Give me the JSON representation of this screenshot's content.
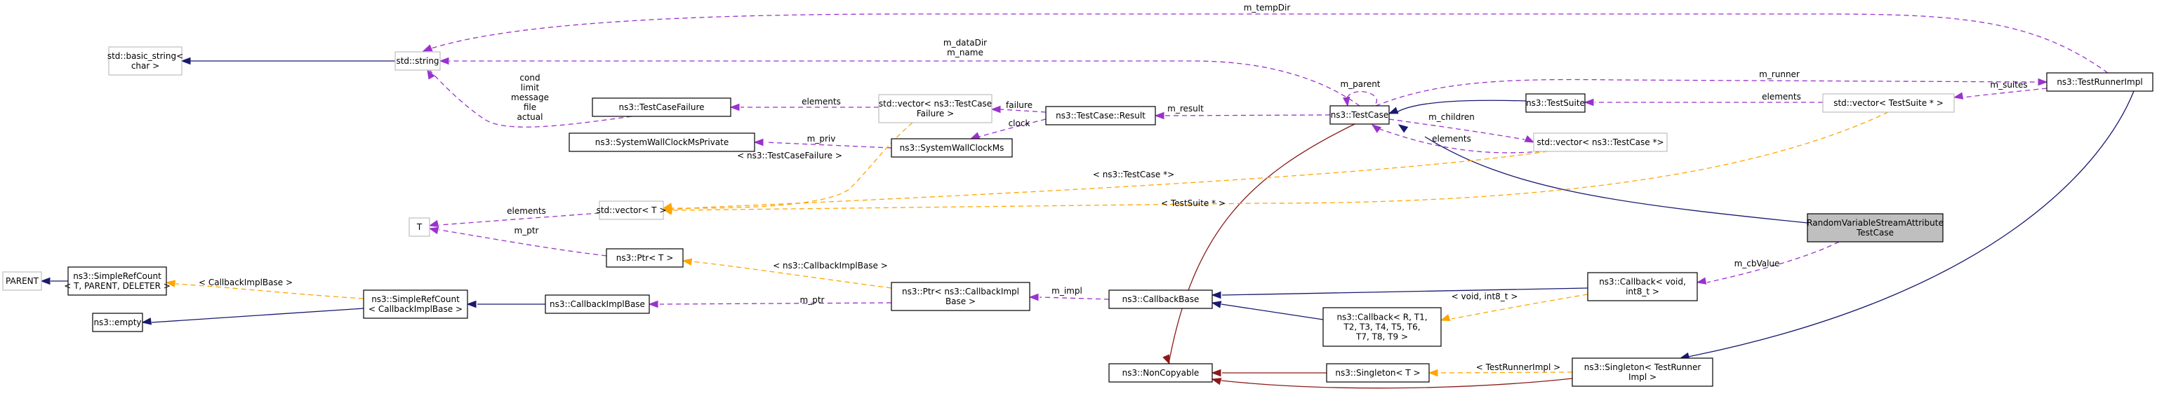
{
  "diagram": {
    "type": "collaboration-graph",
    "focus_node": "RandomVariableStreamAttributeTestCase",
    "colors": {
      "inheritance": "#191970",
      "private_inheritance": "#8b1a1a",
      "usage": "#9a32cd",
      "template_instance": "#ffa500",
      "focus_fill": "#bfbfbf",
      "external_border": "#bfbfbf"
    },
    "nodes": {
      "basic_string": [
        "std::basic_string<",
        "char >"
      ],
      "string": [
        "std::string"
      ],
      "testcasefailure": [
        "ns3::TestCaseFailure"
      ],
      "syswallclockpriv": [
        "ns3::SystemWallClockMsPrivate"
      ],
      "vec_tcf": [
        "std::vector< ns3::TestCase",
        "Failure >"
      ],
      "syswallclock": [
        "ns3::SystemWallClockMs"
      ],
      "result": [
        "ns3::TestCase::Result"
      ],
      "testcase": [
        "ns3::TestCase"
      ],
      "testsuite": [
        "ns3::TestSuite"
      ],
      "vec_ts": [
        "std::vector< TestSuite * >"
      ],
      "testrunnerimpl": [
        "ns3::TestRunnerImpl"
      ],
      "vec_tc": [
        "std::vector< ns3::TestCase *>"
      ],
      "t": [
        "T"
      ],
      "vec_t": [
        "std::vector< T >"
      ],
      "ptr_t": [
        "ns3::Ptr< T >"
      ],
      "parent": [
        "PARENT"
      ],
      "simplerefcount_t": [
        "ns3::SimpleRefCount",
        "< T, PARENT, DELETER >"
      ],
      "empty": [
        "ns3::empty"
      ],
      "simplerefcount_cib": [
        "ns3::SimpleRefCount",
        "< CallbackImplBase >"
      ],
      "callbackimplbase": [
        "ns3::CallbackImplBase"
      ],
      "ptr_cib": [
        "ns3::Ptr< ns3::CallbackImpl",
        "Base >"
      ],
      "callbackbase": [
        "ns3::CallbackBase"
      ],
      "callback_generic": [
        "ns3::Callback< R, T1,",
        "T2, T3, T4, T5, T6,",
        "T7, T8, T9 >"
      ],
      "callback_void": [
        "ns3::Callback< void,",
        "int8_t >"
      ],
      "noncopyable": [
        "ns3::NonCopyable"
      ],
      "singleton_t": [
        "ns3::Singleton< T >"
      ],
      "singleton_tri": [
        "ns3::Singleton< TestRunner",
        "Impl >"
      ],
      "focus": [
        "RandomVariableStreamAttribute",
        "TestCase"
      ]
    },
    "edge_labels": {
      "tempdir": [
        "m_tempDir"
      ],
      "datadir": [
        "m_dataDir",
        "m_name"
      ],
      "failure_strings": [
        "cond",
        "limit",
        "message",
        "file",
        "actual"
      ],
      "elements_tcf": [
        "elements"
      ],
      "m_priv": [
        "m_priv"
      ],
      "failure": [
        "failure"
      ],
      "clock": [
        "clock"
      ],
      "m_result": [
        "m_result"
      ],
      "m_parent": [
        "m_parent"
      ],
      "m_runner": [
        "m_runner"
      ],
      "elements_ts": [
        "elements"
      ],
      "m_suites": [
        "m_suites"
      ],
      "m_children": [
        "m_children"
      ],
      "elements_tc": [
        "elements"
      ],
      "tmpl_tcf": [
        "< ns3::TestCaseFailure >"
      ],
      "tmpl_tc": [
        "< ns3::TestCase *>"
      ],
      "tmpl_ts": [
        "< TestSuite * >"
      ],
      "elements_t": [
        "elements"
      ],
      "m_ptr_t": [
        "m_ptr"
      ],
      "tmpl_cib_ptr": [
        "< ns3::CallbackImplBase >"
      ],
      "tmpl_cib_src": [
        "< CallbackImplBase >"
      ],
      "m_ptr_cib": [
        "m_ptr"
      ],
      "m_impl": [
        "m_impl"
      ],
      "m_cbValue": [
        "m_cbValue"
      ],
      "tmpl_void": [
        "< void, int8_t >"
      ],
      "tmpl_tri": [
        "< TestRunnerImpl >"
      ]
    }
  }
}
